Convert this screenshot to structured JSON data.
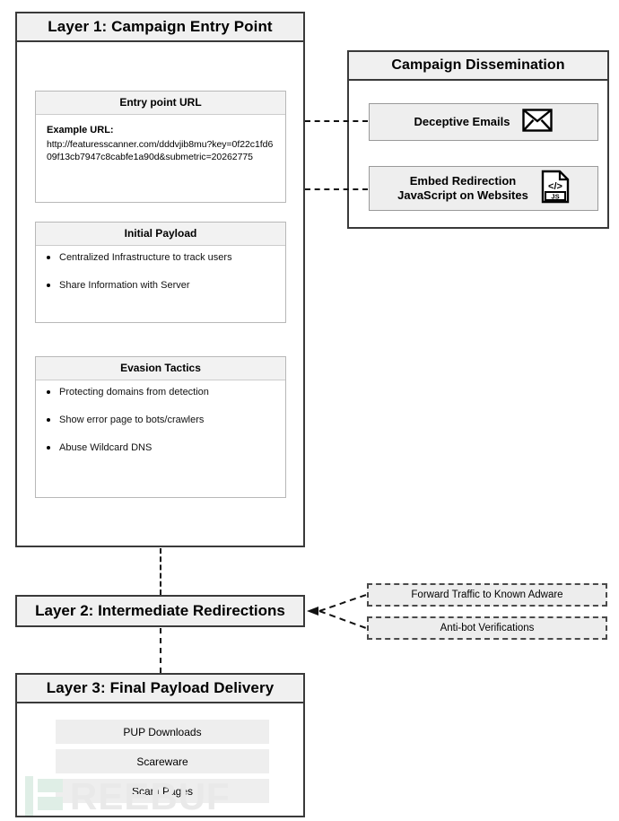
{
  "layer1": {
    "title": "Layer 1: Campaign Entry Point",
    "url_card": {
      "title": "Entry point URL",
      "label": "Example URL:",
      "value": "http://featuresscanner.com/dddvjib8mu?key=0f22c1fd609f13cb7947c8cabfe1a90d&submetric=20262775"
    },
    "payload_card": {
      "title": "Initial Payload",
      "items": [
        "Centralized Infrastructure to track users",
        "Share Information with Server"
      ]
    },
    "evasion_card": {
      "title": "Evasion Tactics",
      "items": [
        "Protecting domains from detection",
        "Show error page to bots/crawlers",
        "Abuse Wildcard DNS"
      ]
    }
  },
  "dissemination": {
    "title": "Campaign Dissemination",
    "items": [
      {
        "label": "Deceptive Emails",
        "icon": "envelope-icon"
      },
      {
        "label": "Embed Redirection\nJavaScript on Websites",
        "label_line1": "Embed Redirection",
        "label_line2": "JavaScript on Websites",
        "icon": "javascript-file-icon",
        "icon_code": "</>",
        "icon_tag": "JS"
      }
    ]
  },
  "layer2": {
    "title": "Layer 2: Intermediate Redirections",
    "branches": [
      "Forward Traffic to Known Adware",
      "Anti-bot Verifications"
    ]
  },
  "layer3": {
    "title": "Layer 3: Final Payload Delivery",
    "items": [
      "PUP Downloads",
      "Scareware",
      "Scam Pages"
    ]
  },
  "watermark": {
    "text": "REEBUF",
    "color": "#e9e9e9",
    "mark_color": "#dfeee6"
  },
  "colors": {
    "panel_border": "#3a3a3a",
    "header_fill": "#f0f0f0",
    "card_border": "#b8b8b8",
    "chip_fill": "#eeeeee",
    "dashed_stroke": "#4a4a4a"
  }
}
